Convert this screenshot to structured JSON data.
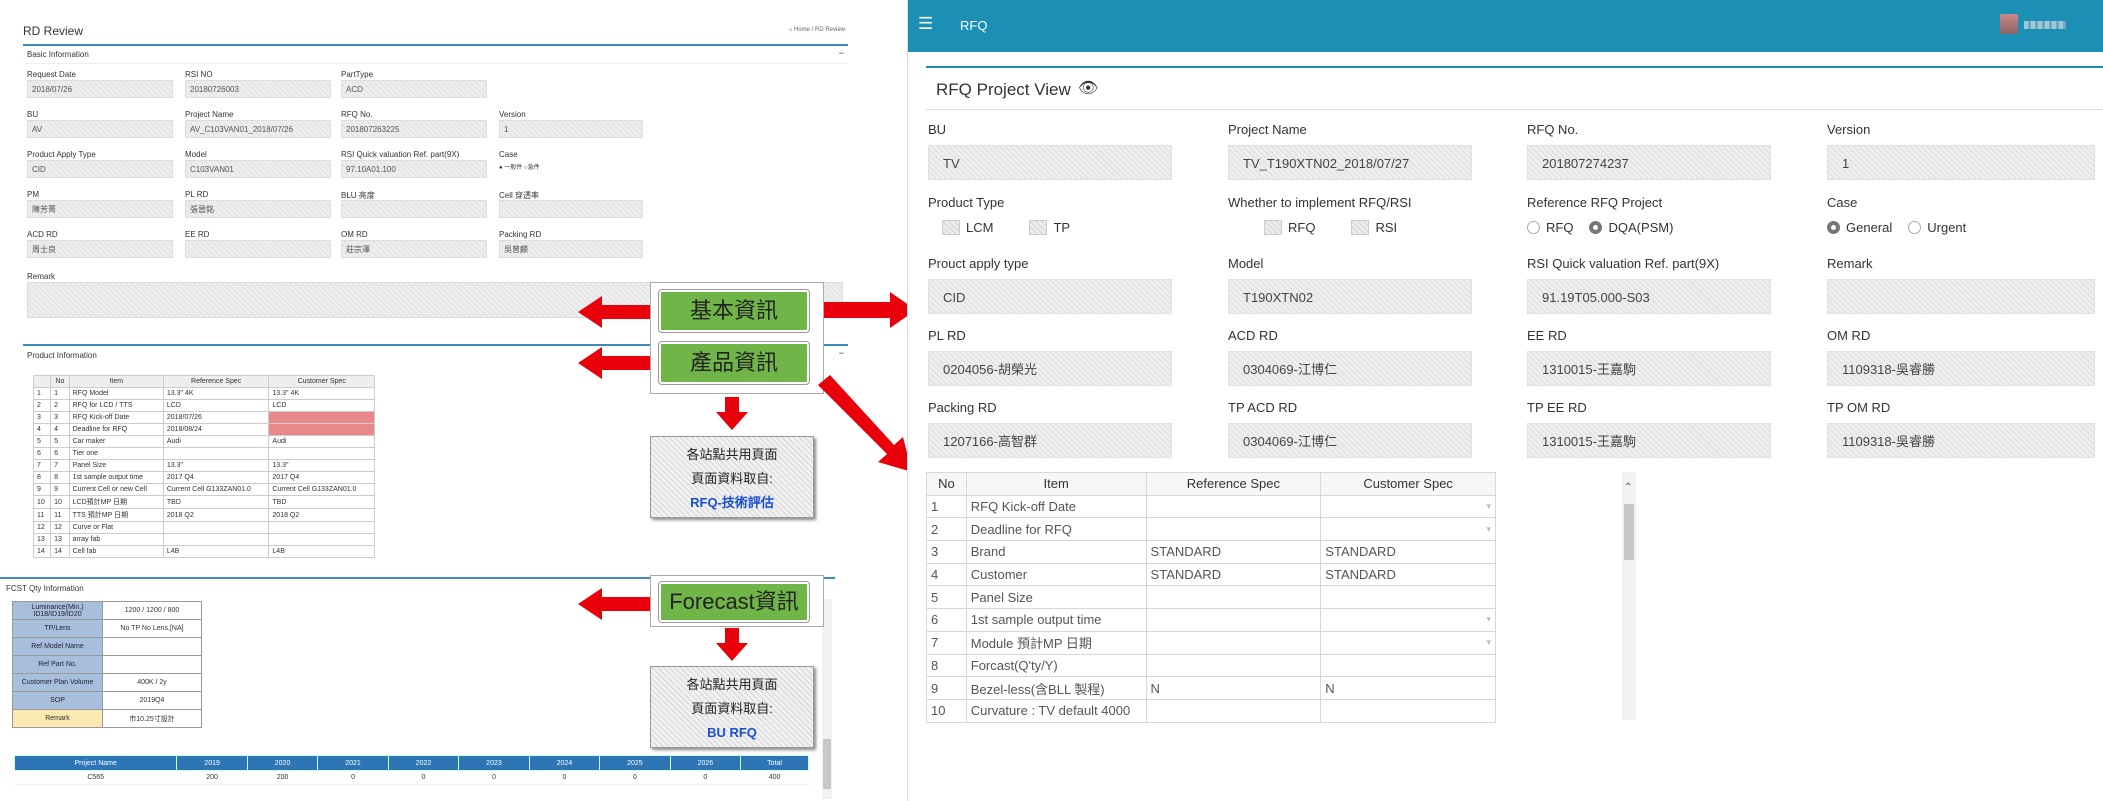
{
  "rd_review": {
    "title": "RD Review",
    "breadcrumb_home": "Home",
    "breadcrumb_current": "RD Review",
    "basic_section": "Basic Information",
    "fields": [
      {
        "label": "Request Date",
        "value": "2018/07/26"
      },
      {
        "label": "RSI NO",
        "value": "20180726003"
      },
      {
        "label": "PartType",
        "value": "ACD"
      },
      {
        "label": "BU",
        "value": "AV"
      },
      {
        "label": "Project Name",
        "value": "AV_C103VAN01_2018/07/26"
      },
      {
        "label": "RFQ No.",
        "value": "201807263225"
      },
      {
        "label": "Version",
        "value": "1"
      },
      {
        "label": "Product Apply Type",
        "value": "CID"
      },
      {
        "label": "Model",
        "value": "C103VAN01"
      },
      {
        "label": "RSI Quick valuation Ref. part(9X)",
        "value": "97.10A01.100"
      },
      {
        "label": "Case",
        "value": ""
      },
      {
        "label": "PM",
        "value": "陳芳菁"
      },
      {
        "label": "PL RD",
        "value": "張晉銘"
      },
      {
        "label": "BLU 亮度",
        "value": ""
      },
      {
        "label": "Cell 穿透率",
        "value": ""
      },
      {
        "label": "ACD RD",
        "value": "周士良"
      },
      {
        "label": "EE RD",
        "value": ""
      },
      {
        "label": "OM RD",
        "value": "莊宗澤"
      },
      {
        "label": "Packing RD",
        "value": "吳曾麟"
      }
    ],
    "case_opt1": "一般件",
    "case_opt2": "急件",
    "remark_label": "Remark",
    "product_section": "Product Information",
    "product_headers": [
      "",
      "No",
      "Item",
      "Reference Spec",
      "Customer Spec"
    ],
    "product_rows": [
      [
        "1",
        "1",
        "RFQ Model",
        "13.3\" 4K",
        "13.3\" 4K"
      ],
      [
        "2",
        "2",
        "RFQ for LCD / TTS",
        "LCD",
        "LCD"
      ],
      [
        "3",
        "3",
        "RFQ Kick-off Date",
        "2018/07/26",
        ""
      ],
      [
        "4",
        "4",
        "Deadline for RFQ",
        "2018/08/24",
        ""
      ],
      [
        "5",
        "5",
        "Car maker",
        "Audi",
        "Audi"
      ],
      [
        "6",
        "6",
        "Tier one",
        "",
        ""
      ],
      [
        "7",
        "7",
        "Panel Size",
        "13.3\"",
        "13.3\""
      ],
      [
        "8",
        "8",
        "1st sample output time",
        "2017 Q4",
        "2017 Q4"
      ],
      [
        "9",
        "9",
        "Current Cell or new Cell",
        "Current Cell G133ZAN01.0",
        "Current Cell G133ZAN01.0"
      ],
      [
        "10",
        "10",
        "LCD預計MP 日期",
        "TBD",
        "TBD"
      ],
      [
        "11",
        "11",
        "TTS 預計MP 日期",
        "2018 Q2",
        "2018 Q2"
      ],
      [
        "12",
        "12",
        "Curve or Flat",
        "",
        ""
      ],
      [
        "13",
        "13",
        "array fab",
        "",
        ""
      ],
      [
        "14",
        "14",
        "Cell fab",
        "L4B",
        "L4B"
      ]
    ],
    "fcst_section": "FCST Qty Information",
    "fcst_rows": [
      {
        "label": "Luminance(Min.) ID18/ID19/ID20",
        "value": "1200 / 1200 / 800"
      },
      {
        "label": "TP/Lens",
        "value": "No TP No Lens,[NA]"
      },
      {
        "label": "Ref Model Name",
        "value": ""
      },
      {
        "label": "Ref Part No.",
        "value": ""
      },
      {
        "label": "Customer Plan Volume",
        "value": "400K / 2y"
      },
      {
        "label": "SOP",
        "value": "2019Q4"
      },
      {
        "label": "Remark",
        "value": "市10.25寸設計"
      }
    ],
    "proj_headers": [
      "Project Name",
      "2019",
      "2020",
      "2021",
      "2022",
      "2023",
      "2024",
      "2025",
      "2026",
      "Total"
    ],
    "proj_row": [
      "C565",
      "200",
      "200",
      "0",
      "0",
      "0",
      "0",
      "0",
      "0",
      "400"
    ]
  },
  "annotations": {
    "basic": "基本資訊",
    "product": "產品資訊",
    "forecast": "Forecast資訊",
    "note1": [
      "各站點共用頁面",
      "頁面資料取自:",
      "RFQ-技術評估"
    ],
    "note2": [
      "各站點共用頁面",
      "頁面資料取自:",
      "BU RFQ"
    ]
  },
  "rfq": {
    "app_title": "RFQ",
    "menu_icon": "☰",
    "view_title": "RFQ Project View",
    "fields": [
      {
        "label": "BU",
        "value": "TV"
      },
      {
        "label": "Project Name",
        "value": "TV_T190XTN02_2018/07/27"
      },
      {
        "label": "RFQ No.",
        "value": "201807274237"
      },
      {
        "label": "Version",
        "value": "1"
      },
      {
        "label": "Prouct apply type",
        "value": "CID"
      },
      {
        "label": "Model",
        "value": "T190XTN02"
      },
      {
        "label": "RSI Quick valuation Ref. part(9X)",
        "value": "91.19T05.000-S03"
      },
      {
        "label": "Remark",
        "value": ""
      },
      {
        "label": "PL RD",
        "value": "0204056-胡榮光"
      },
      {
        "label": "ACD RD",
        "value": "0304069-江博仁"
      },
      {
        "label": "EE RD",
        "value": "1310015-王嘉駒"
      },
      {
        "label": "OM RD",
        "value": "1109318-吳睿勝"
      },
      {
        "label": "Packing RD",
        "value": "1207166-高智群"
      },
      {
        "label": "TP ACD RD",
        "value": "0304069-江博仁"
      },
      {
        "label": "TP EE RD",
        "value": "1310015-王嘉駒"
      },
      {
        "label": "TP OM RD",
        "value": "1109318-吳睿勝"
      }
    ],
    "product_type_label": "Product Type",
    "product_type_opts": [
      "LCM",
      "TP"
    ],
    "implement_label": "Whether to implement RFQ/RSI",
    "implement_opts": [
      "RFQ",
      "RSI"
    ],
    "ref_label": "Reference RFQ Project",
    "ref_opts": [
      "RFQ",
      "DQA(PSM)"
    ],
    "case_label": "Case",
    "case_opts": [
      "General",
      "Urgent"
    ],
    "table_headers": [
      "No",
      "Item",
      "Reference Spec",
      "Customer Spec"
    ],
    "table_rows": [
      [
        "1",
        "RFQ Kick-off Date",
        "",
        ""
      ],
      [
        "2",
        "Deadline for RFQ",
        "",
        ""
      ],
      [
        "3",
        "Brand",
        "STANDARD",
        "STANDARD"
      ],
      [
        "4",
        "Customer",
        "STANDARD",
        "STANDARD"
      ],
      [
        "5",
        "Panel Size",
        "",
        ""
      ],
      [
        "6",
        "1st sample output time",
        "",
        ""
      ],
      [
        "7",
        "Module 預計MP 日期",
        "",
        ""
      ],
      [
        "8",
        "Forcast(Q'ty/Y)",
        "",
        ""
      ],
      [
        "9",
        "Bezel-less(含BLL 製程)",
        "N",
        "N"
      ],
      [
        "10",
        "Curvature : TV default 4000",
        "",
        ""
      ]
    ],
    "accent": "#1b8fb4"
  }
}
